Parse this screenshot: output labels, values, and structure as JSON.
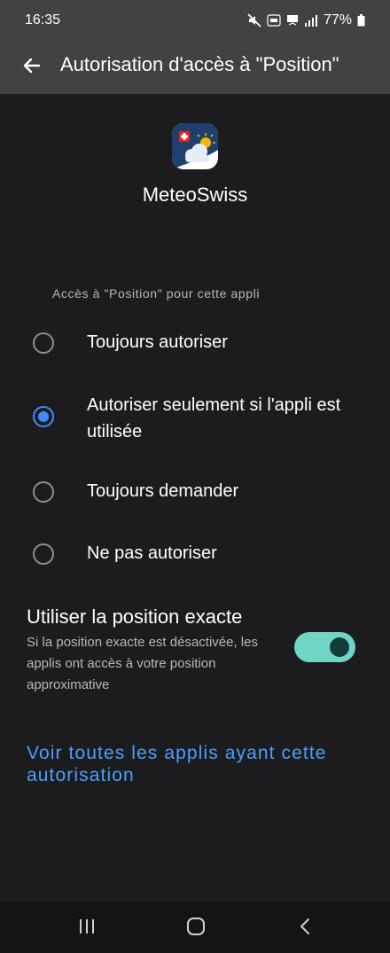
{
  "status_bar": {
    "time": "16:35",
    "battery": "77%"
  },
  "app_bar": {
    "title": "Autorisation d'accès à \"Position\""
  },
  "app": {
    "name": "MeteoSwiss"
  },
  "permission": {
    "section_label": "Accès à \"Position\" pour cette appli",
    "options": [
      {
        "label": "Toujours autoriser",
        "selected": false
      },
      {
        "label": "Autoriser seulement si l'appli est utilisée",
        "selected": true
      },
      {
        "label": "Toujours demander",
        "selected": false
      },
      {
        "label": "Ne pas autoriser",
        "selected": false
      }
    ]
  },
  "precise_location": {
    "title": "Utiliser la position exacte",
    "description": "Si la position exacte est désactivée, les applis ont accès à votre position approximative",
    "enabled": true
  },
  "see_all_link": "Voir toutes les applis ayant cette autorisation",
  "colors": {
    "accent": "#3f8cff",
    "link": "#4d9eff",
    "toggle_track": "#6fd5c5",
    "background": "#1c1c1e",
    "app_bar": "#424242"
  },
  "icons": {
    "back": "arrow-left-icon",
    "recents": "recents-icon",
    "home": "home-icon",
    "nav_back": "chevron-left-icon"
  }
}
